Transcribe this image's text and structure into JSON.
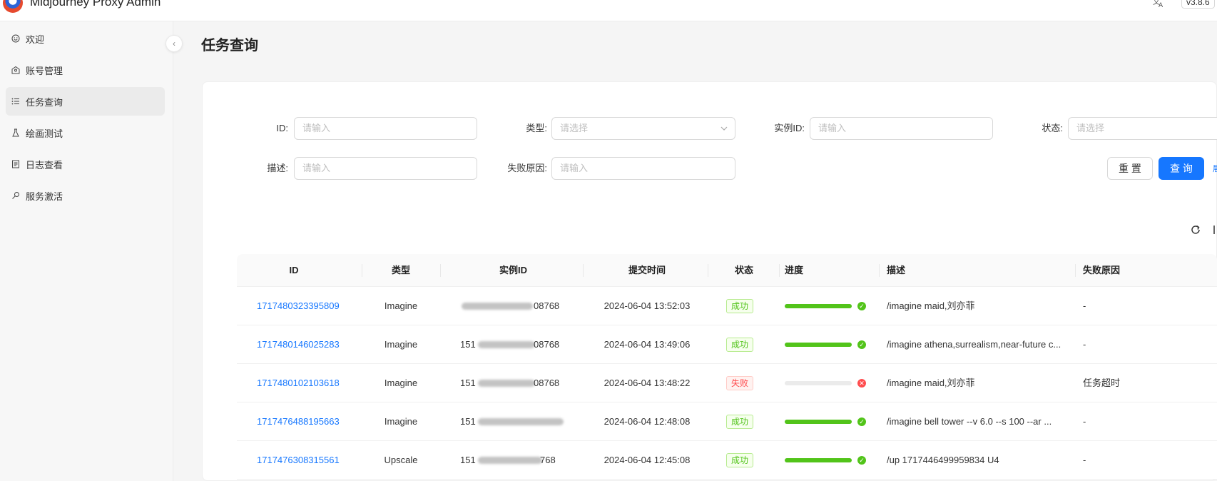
{
  "app": {
    "title": "Midjourney Proxy Admin",
    "version": "v3.8.6",
    "translate_icon": "translate-icon"
  },
  "sidebar": {
    "items": [
      {
        "label": "欢迎",
        "icon": "smile-icon"
      },
      {
        "label": "账号管理",
        "icon": "account-icon"
      },
      {
        "label": "任务查询",
        "icon": "list-icon",
        "active": true
      },
      {
        "label": "绘画测试",
        "icon": "flask-icon"
      },
      {
        "label": "日志查看",
        "icon": "log-icon"
      },
      {
        "label": "服务激活",
        "icon": "key-icon"
      }
    ],
    "collapse_glyph": "‹"
  },
  "page": {
    "title": "任务查询"
  },
  "filters": {
    "id": {
      "label": "ID:",
      "placeholder": "请输入"
    },
    "type": {
      "label": "类型:",
      "placeholder": "请选择"
    },
    "instance_id": {
      "label": "实例ID:",
      "placeholder": "请输入"
    },
    "status": {
      "label": "状态:",
      "placeholder": "请选择"
    },
    "description": {
      "label": "描述:",
      "placeholder": "请输入"
    },
    "fail_reason": {
      "label": "失败原因:",
      "placeholder": "请输入"
    },
    "reset_label": "重 置",
    "query_label": "查 询"
  },
  "table": {
    "columns": [
      "ID",
      "类型",
      "实例ID",
      "提交时间",
      "状态",
      "进度",
      "描述",
      "失败原因"
    ],
    "rows": [
      {
        "id": "1717480323395809",
        "type": "Imagine",
        "instance_suffix": "08768",
        "submit_time": "2024-06-04 13:52:03",
        "status": "成功",
        "status_kind": "success",
        "progress": 1.0,
        "description": "/imagine maid,刘亦菲",
        "fail_reason": "-"
      },
      {
        "id": "1717480146025283",
        "type": "Imagine",
        "instance_prefix": "151",
        "instance_suffix": "08768",
        "submit_time": "2024-06-04 13:49:06",
        "status": "成功",
        "status_kind": "success",
        "progress": 1.0,
        "description": "/imagine athena,surrealism,near-future c...",
        "fail_reason": "-"
      },
      {
        "id": "1717480102103618",
        "type": "Imagine",
        "instance_prefix": "151",
        "instance_suffix": "08768",
        "submit_time": "2024-06-04 13:48:22",
        "status": "失败",
        "status_kind": "error",
        "progress": 0.0,
        "description": "/imagine maid,刘亦菲",
        "fail_reason": "任务超时"
      },
      {
        "id": "1717476488195663",
        "type": "Imagine",
        "instance_prefix": "151",
        "submit_time": "2024-06-04 12:48:08",
        "status": "成功",
        "status_kind": "success",
        "progress": 1.0,
        "description": "/imagine bell tower --v 6.0 --s 100 --ar ...",
        "fail_reason": "-"
      },
      {
        "id": "1717476308315561",
        "type": "Upscale",
        "instance_prefix": "151",
        "instance_suffix": "768",
        "submit_time": "2024-06-04 12:45:08",
        "status": "成功",
        "status_kind": "success",
        "progress": 1.0,
        "description": "/up 1717446499959834 U4",
        "fail_reason": "-"
      }
    ]
  },
  "toolbar": {
    "reload_icon": "reload-icon"
  },
  "colors": {
    "primary": "#1677ff",
    "success": "#52c41a",
    "error": "#ff4d4f"
  }
}
